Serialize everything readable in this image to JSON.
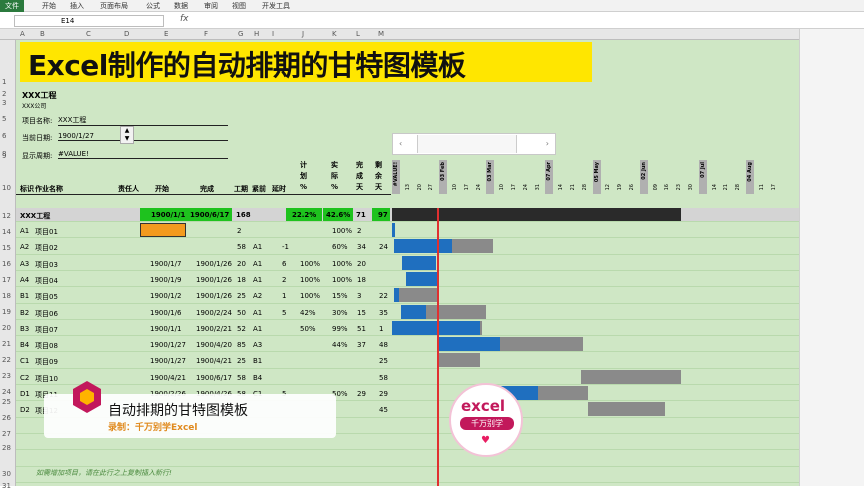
{
  "ribbon": {
    "tabs": [
      "文件",
      "开始",
      "插入",
      "页面布局",
      "公式",
      "数据",
      "审阅",
      "视图",
      "开发工具"
    ]
  },
  "namebox": {
    "value": "E14"
  },
  "formula": {
    "fx": "fx"
  },
  "columns": [
    "A",
    "B",
    "C",
    "D",
    "E",
    "F",
    "G",
    "H",
    "I",
    "J",
    "K",
    "L",
    "M"
  ],
  "rows": [
    "1",
    "2",
    "3",
    "5",
    "6",
    "8",
    "9",
    "10",
    "12",
    "14",
    "15",
    "16",
    "17",
    "18",
    "19",
    "20",
    "21",
    "22",
    "23",
    "24",
    "25",
    "26",
    "27",
    "28",
    "30",
    "31"
  ],
  "title": "Excel制作的自动排期的甘特图模板",
  "project": {
    "name_big": "XXX工程",
    "company": "XXX公司",
    "label_name": "项目名称:",
    "value_name": "XXX工程",
    "label_date": "当前日期:",
    "value_date": "1900/1/27",
    "label_week": "显示周期:",
    "value_week": "#VALUE!"
  },
  "headers": {
    "id": "标识",
    "task": "作业名称",
    "owner": "责任人",
    "start": "开始",
    "end": "完成",
    "days": "工期",
    "dep": "紧前",
    "delay": "延时",
    "plan": "计\n划\n%",
    "actual": "实\n际\n%",
    "done_days": "完\n成\n天",
    "left_days": "剩\n余\n天"
  },
  "total": {
    "name": "XXX工程",
    "start": "1900/1/1",
    "end": "1900/6/17",
    "days": "168",
    "plan": "22.2%",
    "actual": "42.6%",
    "done": "71",
    "left": "97"
  },
  "tasks": [
    {
      "id": "A1",
      "name": "项目01",
      "start": "",
      "end": "",
      "days": "2",
      "dep": "",
      "delay": "",
      "plan": "",
      "actual": "100%",
      "done": "2",
      "left": ""
    },
    {
      "id": "A2",
      "name": "项目02",
      "start": "",
      "end": "",
      "days": "58",
      "dep": "A1",
      "delay": "-1",
      "plan": "",
      "actual": "60%",
      "done": "34",
      "left": "24"
    },
    {
      "id": "A3",
      "name": "项目03",
      "start": "1900/1/7",
      "end": "1900/1/26",
      "days": "20",
      "dep": "A1",
      "delay": "6",
      "plan": "100%",
      "actual": "100%",
      "done": "20",
      "left": ""
    },
    {
      "id": "A4",
      "name": "项目04",
      "start": "1900/1/9",
      "end": "1900/1/26",
      "days": "18",
      "dep": "A1",
      "delay": "2",
      "plan": "100%",
      "actual": "100%",
      "done": "18",
      "left": ""
    },
    {
      "id": "B1",
      "name": "项目05",
      "start": "1900/1/2",
      "end": "1900/1/26",
      "days": "25",
      "dep": "A2",
      "delay": "1",
      "plan": "100%",
      "actual": "15%",
      "done": "3",
      "left": "22"
    },
    {
      "id": "B2",
      "name": "项目06",
      "start": "1900/1/6",
      "end": "1900/2/24",
      "days": "50",
      "dep": "A1",
      "delay": "5",
      "plan": "42%",
      "actual": "30%",
      "done": "15",
      "left": "35"
    },
    {
      "id": "B3",
      "name": "项目07",
      "start": "1900/1/1",
      "end": "1900/2/21",
      "days": "52",
      "dep": "A1",
      "delay": "",
      "plan": "50%",
      "actual": "99%",
      "done": "51",
      "left": "1"
    },
    {
      "id": "B4",
      "name": "项目08",
      "start": "1900/1/27",
      "end": "1900/4/20",
      "days": "85",
      "dep": "A3",
      "delay": "",
      "plan": "",
      "actual": "44%",
      "done": "37",
      "left": "48"
    },
    {
      "id": "C1",
      "name": "项目09",
      "start": "1900/1/27",
      "end": "1900/4/21",
      "days": "25",
      "dep": "B1",
      "delay": "",
      "plan": "",
      "actual": "",
      "done": "",
      "left": "25"
    },
    {
      "id": "C2",
      "name": "项目10",
      "start": "1900/4/21",
      "end": "1900/6/17",
      "days": "58",
      "dep": "B4",
      "delay": "",
      "plan": "",
      "actual": "",
      "done": "",
      "left": "58"
    },
    {
      "id": "D1",
      "name": "项目11",
      "start": "1900/2/26",
      "end": "1900/4/26",
      "days": "58",
      "dep": "C1",
      "delay": "5",
      "plan": "",
      "actual": "50%",
      "done": "29",
      "left": "29"
    },
    {
      "id": "D2",
      "name": "项目12",
      "start": "",
      "end": "",
      "days": "",
      "dep": "",
      "delay": "",
      "plan": "",
      "actual": "",
      "done": "",
      "left": "45"
    }
  ],
  "date_headers": [
    "#VALUE!",
    "13",
    "20",
    "27",
    "03 Feb",
    "10",
    "17",
    "24",
    "03 Mar",
    "10",
    "17",
    "24",
    "31",
    "07 Apr",
    "14",
    "21",
    "28",
    "05 May",
    "12",
    "19",
    "26",
    "02 Jun",
    "09",
    "16",
    "23",
    "30",
    "07 Jul",
    "14",
    "21",
    "28",
    "04 Aug",
    "11",
    "17"
  ],
  "footer_note": "如需增加项目，请在此行之上复制插入新行!",
  "banner": {
    "title": "自动排期的甘特图模板",
    "subtitle": "录制：千万别学Excel"
  },
  "watermark": {
    "line1": "excel",
    "line2": "千万别学"
  },
  "colors": {
    "sheet_bg": "#cfe7c5",
    "title_bg": "#ffe600",
    "bar_done": "#1f6fbf",
    "bar_left": "#8a8a8a",
    "today_line": "#e03030",
    "green_cell": "#1ec21e"
  }
}
